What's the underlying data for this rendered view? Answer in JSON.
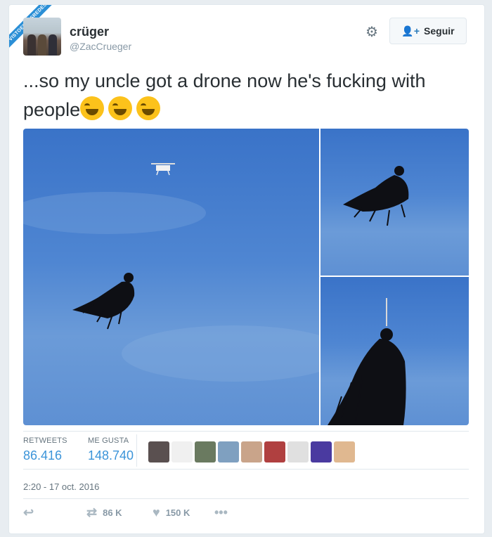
{
  "badge": {
    "text": "VISTOENLASREDES"
  },
  "user": {
    "name": "crüger",
    "handle": "@ZacCrueger"
  },
  "header": {
    "follow_label": "Seguir"
  },
  "tweet": {
    "text": "...so my uncle got a drone now he's fucking with people",
    "emoji_count": 3
  },
  "stats": {
    "retweets_label": "RETWEETS",
    "retweets_value": "86.416",
    "likes_label": "ME GUSTA",
    "likes_value": "148.740"
  },
  "likers": [
    "#5a5050",
    "#f0f0f0",
    "#6a7a60",
    "#7fa0c0",
    "#c9a48a",
    "#b04040",
    "#e0e0e0",
    "#4a3aa0",
    "#e0b890"
  ],
  "timestamp": "2:20 - 17 oct. 2016",
  "actions": {
    "retweet_count": "86 K",
    "like_count": "150 K"
  },
  "colors": {
    "accent": "#3b94d9",
    "sky": "#4f86d2"
  }
}
